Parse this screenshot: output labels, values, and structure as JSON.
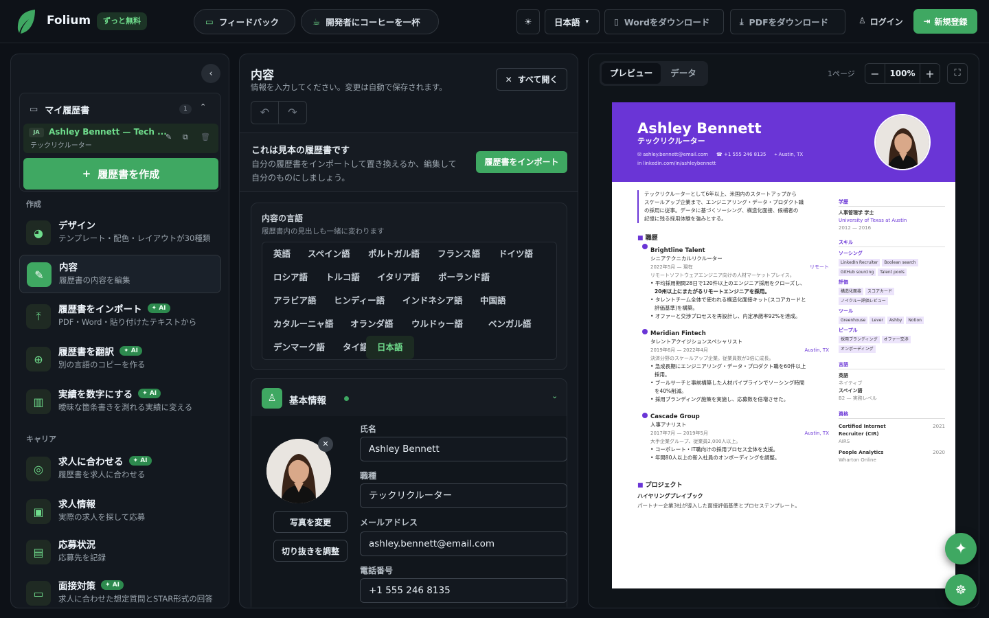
{
  "header": {
    "brand": "Folium",
    "free_badge": "ずっと無料",
    "feedback": "フィードバック",
    "coffee": "開発者にコーヒーを一杯",
    "language": "日本語",
    "word_download": "Wordをダウンロード",
    "pdf_download": "PDFをダウンロード",
    "login": "ログイン",
    "signup": "新規登録"
  },
  "sidebar": {
    "my_resumes": "マイ履歴書",
    "count": "1",
    "resume_lang": "JA",
    "resume_title": "Ashley Bennett — Tech ...",
    "resume_sub": "テックリクルーター",
    "create_button": "履歴書を作成",
    "section_create": "作成",
    "section_career": "キャリア",
    "ai_badge": "AI",
    "items": [
      {
        "title": "デザイン",
        "sub": "テンプレート・配色・レイアウトが30種類",
        "ai": false,
        "icon": "palette-icon"
      },
      {
        "title": "内容",
        "sub": "履歴書の内容を編集",
        "ai": false,
        "icon": "pencil-icon"
      },
      {
        "title": "履歴書をインポート",
        "sub": "PDF・Word・貼り付けたテキストから",
        "ai": true,
        "icon": "upload-icon"
      },
      {
        "title": "履歴書を翻訳",
        "sub": "別の言語のコピーを作る",
        "ai": true,
        "icon": "globe-icon"
      },
      {
        "title": "実績を数字にする",
        "sub": "曖昧な箇条書きを測れる実績に変える",
        "ai": true,
        "icon": "bar-chart-icon"
      },
      {
        "title": "求人に合わせる",
        "sub": "履歴書を求人に合わせる",
        "ai": true,
        "icon": "target-icon"
      },
      {
        "title": "求人情報",
        "sub": "実際の求人を探して応募",
        "ai": false,
        "icon": "briefcase-icon"
      },
      {
        "title": "応募状況",
        "sub": "応募先を記録",
        "ai": false,
        "icon": "kanban-icon"
      },
      {
        "title": "面接対策",
        "sub": "求人に合わせた想定質問とSTAR形式の回答",
        "ai": true,
        "icon": "chat-icon"
      }
    ]
  },
  "content": {
    "title": "内容",
    "subtitle": "情報を入力してください。変更は自動で保存されます。",
    "expand_all": "すべて開く",
    "sample_title": "これは見本の履歴書です",
    "sample_desc_1": "自分の履歴書をインポートして置き換えるか、編集して",
    "sample_desc_2": "自分のものにしましょう。",
    "import_button": "履歴書をインポート",
    "lang_title": "内容の言語",
    "lang_sub": "履歴書内の見出しも一緒に変わります",
    "languages": [
      "英語",
      "スペイン語",
      "ポルトガル語",
      "フランス語",
      "ドイツ語",
      "ロシア語",
      "トルコ語",
      "イタリア語",
      "ポーランド語",
      "アラビア語",
      "ヒンディー語",
      "インドネシア語",
      "中国語",
      "カタルーニャ語",
      "オランダ語",
      "ウルドゥー語",
      "ベンガル語",
      "デンマーク語",
      "タイ語",
      "日本語"
    ],
    "selected_language": "日本語",
    "basic_info": "基本情報",
    "change_photo": "写真を変更",
    "crop_photo": "切り抜きを調整",
    "name_label": "氏名",
    "name_value": "Ashley Bennett",
    "title_label": "職種",
    "title_value": "テックリクルーター",
    "email_label": "メールアドレス",
    "email_value": "ashley.bennett@email.com",
    "phone_label": "電話番号",
    "phone_value": "+1 555 246 8135"
  },
  "preview": {
    "tab_preview": "プレビュー",
    "tab_data": "データ",
    "pages": "1ページ",
    "zoom": "100%",
    "resume": {
      "name": "Ashley Bennett",
      "title": "テックリクルーター",
      "email": "ashley.bennett@email.com",
      "phone": "+1 555 246 8135",
      "location": "Austin, TX",
      "linkedin": "linkedin.com/in/ashleybennett",
      "summary_1": "テックリクルーターとして6年以上、米国内のスタートアップから",
      "summary_2": "スケールアップ企業まで、エンジニアリング・データ・プロダクト職",
      "summary_3": "の採用に従事。データに基づくソーシング、構造化面接、候補者の",
      "summary_4": "記憶に残る採用体験を強みとする。",
      "experience_heading": "職歴",
      "jobs": [
        {
          "company": "Brightline Talent",
          "role": "シニアテクニカルリクルーター",
          "dates": "2022年5月 — 現在",
          "loc": "リモート",
          "desc": "リモートソフトウェアエンジニア向けの人材マーケットプレイス。",
          "bullets": [
            "平均採用期間28日で120件以上のエンジニア採用をクローズし、",
            "20州以上にまたがるリモートエンジニアを採用。",
            "タレントチーム全体で使われる構造化面接キット(スコアカードと",
            "評価基準)を構築。",
            "オファーと交渉プロセスを再設計し、内定承諾率92%を達成。"
          ]
        },
        {
          "company": "Meridian Fintech",
          "role": "タレントアクイジションスペシャリスト",
          "dates": "2019年6月 — 2022年4月",
          "loc": "Austin, TX",
          "desc": "決済分野のスケールアップ企業。従業員数が3倍に成長。",
          "bullets": [
            "急成長期にエンジニアリング・データ・プロダクト職を60件以上",
            "採用。",
            "ブールサーチと事前構築した人材パイプラインでソーシング時間",
            "を40%削減。",
            "採用ブランディング施策を実施し、応募数を倍増させた。"
          ]
        },
        {
          "company": "Cascade Group",
          "role": "人事アナリスト",
          "dates": "2017年7月 — 2019年5月",
          "loc": "Austin, TX",
          "desc": "大手企業グループ、従業員2,000人以上。",
          "bullets": [
            "コーポレート・IT職向けの採用プロセス全体を支援。",
            "年間80人以上の新入社員のオンボーディングを調整。"
          ]
        }
      ],
      "projects_heading": "プロジェクト",
      "project_name": "ハイヤリングプレイブック",
      "project_desc": "パートナー企業3社が導入した面接評価基準とプロセステンプレート。",
      "education_heading": "学歴",
      "degree": "人事管理学 学士",
      "school": "University of Texas at Austin",
      "edu_years": "2012 — 2016",
      "skills_heading": "スキル",
      "skill_groups": [
        {
          "name": "ソーシング",
          "tags": [
            "LinkedIn Recruiter",
            "Boolean search",
            "GitHub sourcing",
            "Talent pools"
          ]
        },
        {
          "name": "評価",
          "tags": [
            "構造化面接",
            "スコアカード",
            "ノイクルー評価レビュー"
          ]
        },
        {
          "name": "ツール",
          "tags": [
            "Greenhouse",
            "Lever",
            "Ashby",
            "Notion"
          ]
        },
        {
          "name": "ピープル",
          "tags": [
            "採用ブランディング",
            "オファー交渉",
            "オンボーディング"
          ]
        }
      ],
      "languages_heading": "言語",
      "lang_items": [
        {
          "name": "英語",
          "level": "ネイティブ"
        },
        {
          "name": "スペイン語",
          "level": "B2 — 実務レベル"
        }
      ],
      "certs_heading": "資格",
      "certs": [
        {
          "name1": "Certified Internet",
          "name2": "Recruiter (CIR)",
          "issuer": "AIRS",
          "year": "2021"
        },
        {
          "name1": "People Analytics",
          "name2": "",
          "issuer": "Wharton Online",
          "year": "2020"
        }
      ]
    }
  },
  "colors": {
    "accent": "#3fa862",
    "resume_header": "#6a35d6",
    "bg": "#0d1117"
  }
}
